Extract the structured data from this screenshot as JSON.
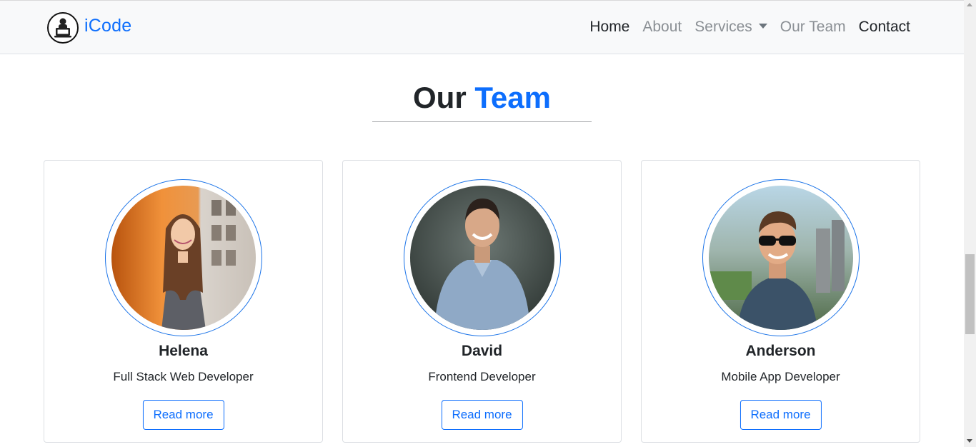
{
  "navbar": {
    "brand": "iCode",
    "brand_logo_icon": "coder-laptop-logo-icon",
    "links": [
      {
        "label": "Home"
      },
      {
        "label": "About"
      },
      {
        "label": "Services"
      },
      {
        "label": "Our Team"
      },
      {
        "label": "Contact"
      }
    ]
  },
  "section": {
    "title_part1": "Our",
    "title_part2": "Team"
  },
  "team": [
    {
      "name": "Helena",
      "role": "Full Stack Web Developer",
      "button": "Read more"
    },
    {
      "name": "David",
      "role": "Frontend Developer",
      "button": "Read more"
    },
    {
      "name": "Anderson",
      "role": "Mobile App Developer",
      "button": "Read more"
    }
  ],
  "colors": {
    "accent": "#0d6efd",
    "navbar_bg": "#f8f9fa",
    "text": "#212529",
    "muted_link": "#8a8f94"
  }
}
